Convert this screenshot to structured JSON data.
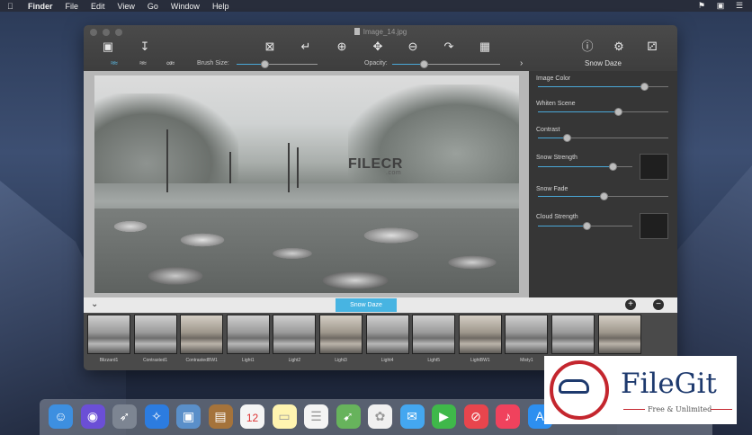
{
  "menubar": {
    "apple_icon": "apple-icon",
    "items": [
      "Finder",
      "File",
      "Edit",
      "View",
      "Go",
      "Window",
      "Help"
    ],
    "status_icons": [
      "flag-icon",
      "display-icon",
      "list-icon"
    ]
  },
  "window": {
    "title": "Image_14.jpg",
    "toolbar_icons": [
      "image-icon",
      "export-icon",
      "crop-icon",
      "rotate-icon",
      "zoom-in-icon",
      "move-icon",
      "zoom-out-icon",
      "redo-icon",
      "compare-icon",
      "info-icon",
      "settings-icon",
      "share-icon"
    ],
    "brush_size_label": "Brush Size:",
    "brush_size": 0.35,
    "opacity_label": "Opacity:",
    "opacity": 0.3,
    "panel_title": "Snow Daze"
  },
  "photo": {
    "watermark": "FILECR",
    "watermark_sub": ".com"
  },
  "adjustments": [
    {
      "label": "Image Color",
      "value": 0.82,
      "swatch": false
    },
    {
      "label": "Whiten Scene",
      "value": 0.62,
      "swatch": false
    },
    {
      "label": "Contrast",
      "value": 0.23,
      "swatch": false
    },
    {
      "label": "Snow Strength",
      "value": 0.8,
      "swatch": true
    },
    {
      "label": "Snow Fade",
      "value": 0.51,
      "swatch": false
    },
    {
      "label": "Cloud Strength",
      "value": 0.52,
      "swatch": true
    }
  ],
  "strip": {
    "selected": "Snow Daze",
    "add_label": "+",
    "remove_label": "−"
  },
  "presets": [
    "Blizzard1",
    "Contrasted1",
    "ContrastedBW1",
    "Light1",
    "Light2",
    "Light3",
    "Light4",
    "Light5",
    "LightBW1",
    "Misty1",
    "",
    ""
  ],
  "dock": {
    "icons": [
      "finder-icon",
      "siri-icon",
      "launchpad-icon",
      "safari-icon",
      "preview-icon",
      "notebook-icon",
      "calendar-icon",
      "notes-icon",
      "reminders-icon",
      "maps-icon",
      "photos-icon",
      "messages-icon",
      "facetime-icon",
      "news-icon",
      "music-icon",
      "appstore-icon"
    ],
    "calendar_day": "12",
    "calendar_month": "JUL"
  },
  "filegit": {
    "name": "FileGit",
    "tagline": "Free & Unlimited"
  },
  "colors": {
    "accent": "#47b4e2",
    "filegit_blue": "#1e3a6e",
    "filegit_red": "#c4262e"
  }
}
